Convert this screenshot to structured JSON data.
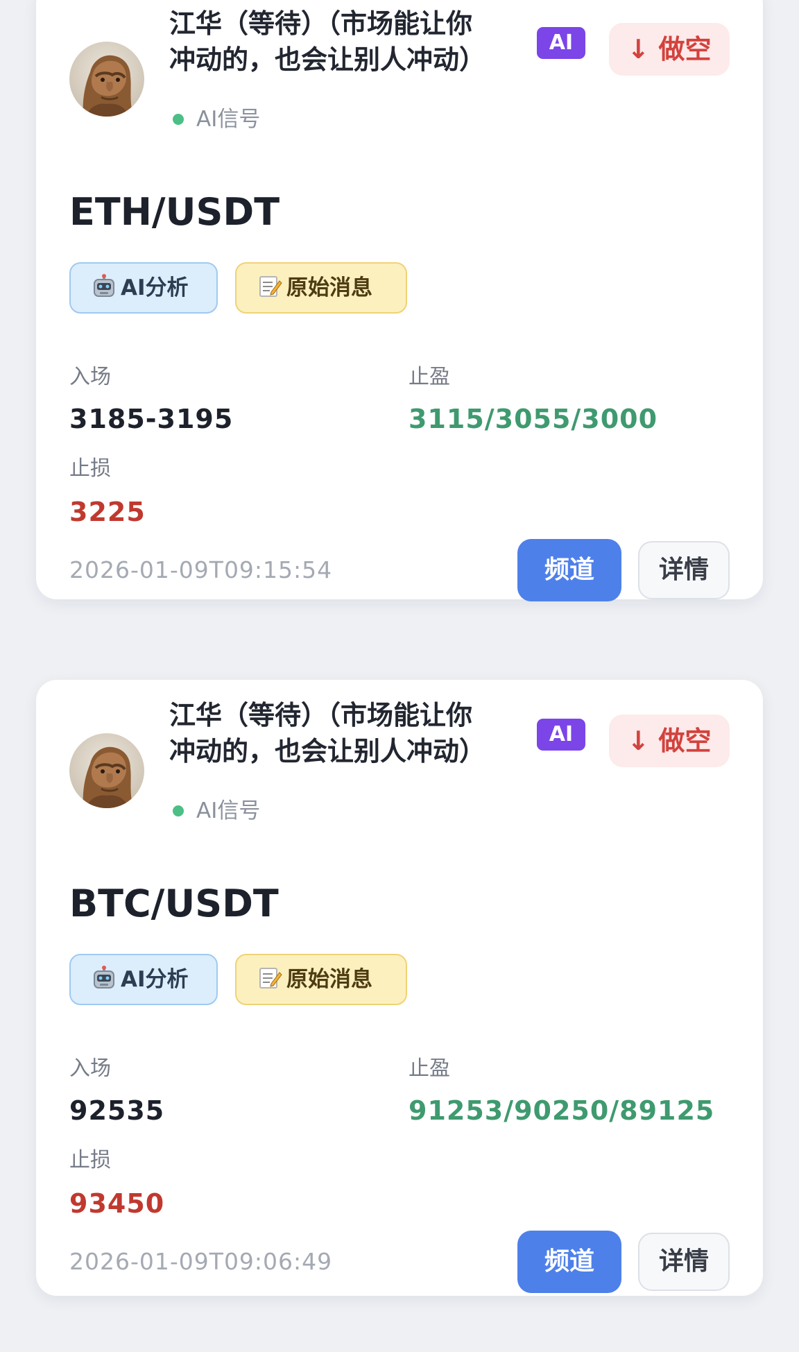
{
  "signals": [
    {
      "author": {
        "name_line1": "江华（等待）（市场能让你",
        "name_line2": "冲动的，也会让别人冲动）",
        "avatar_icon": "ape-avatar",
        "source_label": "AI信号"
      },
      "ai_badge": "AI",
      "direction_label": "↓ 做空",
      "pair": "ETH/USDT",
      "tags": [
        {
          "label": "AI分析",
          "icon": "robot-icon"
        },
        {
          "label": "原始消息",
          "icon": "memo-icon"
        }
      ],
      "entry": {
        "label": "入场",
        "value": "3185-3195"
      },
      "take_profit": {
        "label": "止盈",
        "value": "3115/3055/3000"
      },
      "stop_loss": {
        "label": "止损",
        "value": "3225"
      },
      "timestamp": "2026-01-09T09:15:54",
      "actions": {
        "channel_label": "频道",
        "detail_label": "详情"
      }
    },
    {
      "author": {
        "name_line1": "江华（等待）（市场能让你",
        "name_line2": "冲动的，也会让别人冲动）",
        "avatar_icon": "ape-avatar",
        "source_label": "AI信号"
      },
      "ai_badge": "AI",
      "direction_label": "↓ 做空",
      "pair": "BTC/USDT",
      "tags": [
        {
          "label": "AI分析",
          "icon": "robot-icon"
        },
        {
          "label": "原始消息",
          "icon": "memo-icon"
        }
      ],
      "entry": {
        "label": "入场",
        "value": "92535"
      },
      "take_profit": {
        "label": "止盈",
        "value": "91253/90250/89125"
      },
      "stop_loss": {
        "label": "止损",
        "value": "93450"
      },
      "timestamp": "2026-01-09T09:06:49",
      "actions": {
        "channel_label": "频道",
        "detail_label": "详情"
      }
    }
  ],
  "colors": {
    "short": "#d2423d",
    "take_profit": "#3f9a6f",
    "stop_loss": "#c0392f",
    "primary_button": "#4e80ea",
    "ai_badge": "#7b45e8",
    "status_dot": "#4bbf86"
  }
}
